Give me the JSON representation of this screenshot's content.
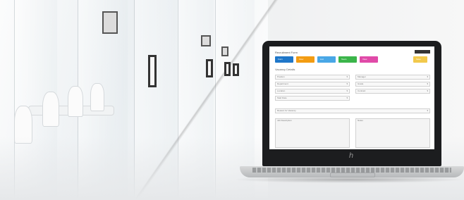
{
  "scene": {
    "background": "#f2f3f4",
    "accent_colors": {
      "blue": "#1f77c9",
      "orange": "#f39c12",
      "sky": "#49a7e6",
      "green": "#3bb54a",
      "pink": "#e04aa8",
      "yellow": "#f2c94c"
    }
  },
  "laptop": {
    "brand_logo": "hp-logo"
  },
  "screen": {
    "title": "Recruitment Form",
    "tiles": [
      {
        "label": "Form",
        "color": "#1f77c9"
      },
      {
        "label": "Flow",
        "color": "#f39c12"
      },
      {
        "label": "List",
        "color": "#49a7e6"
      },
      {
        "label": "Team",
        "color": "#3bb54a"
      },
      {
        "label": "View",
        "color": "#e04aa8"
      }
    ],
    "right_tile": {
      "label": "Save",
      "color": "#f2c94c"
    },
    "section_title": "Vacancy Details",
    "fields_left": [
      {
        "label": "Position",
        "value": ""
      },
      {
        "label": "Department",
        "value": ""
      },
      {
        "label": "Location",
        "value": ""
      },
      {
        "label": "Start Date",
        "value": ""
      }
    ],
    "fields_right": [
      {
        "label": "Manager",
        "value": ""
      },
      {
        "label": "Grade",
        "value": ""
      },
      {
        "label": "Contract",
        "value": ""
      }
    ],
    "wide_field": {
      "label": "Reason for Vacancy",
      "value": ""
    },
    "text_areas": [
      {
        "label": "Job Description"
      },
      {
        "label": "Notes"
      }
    ]
  }
}
